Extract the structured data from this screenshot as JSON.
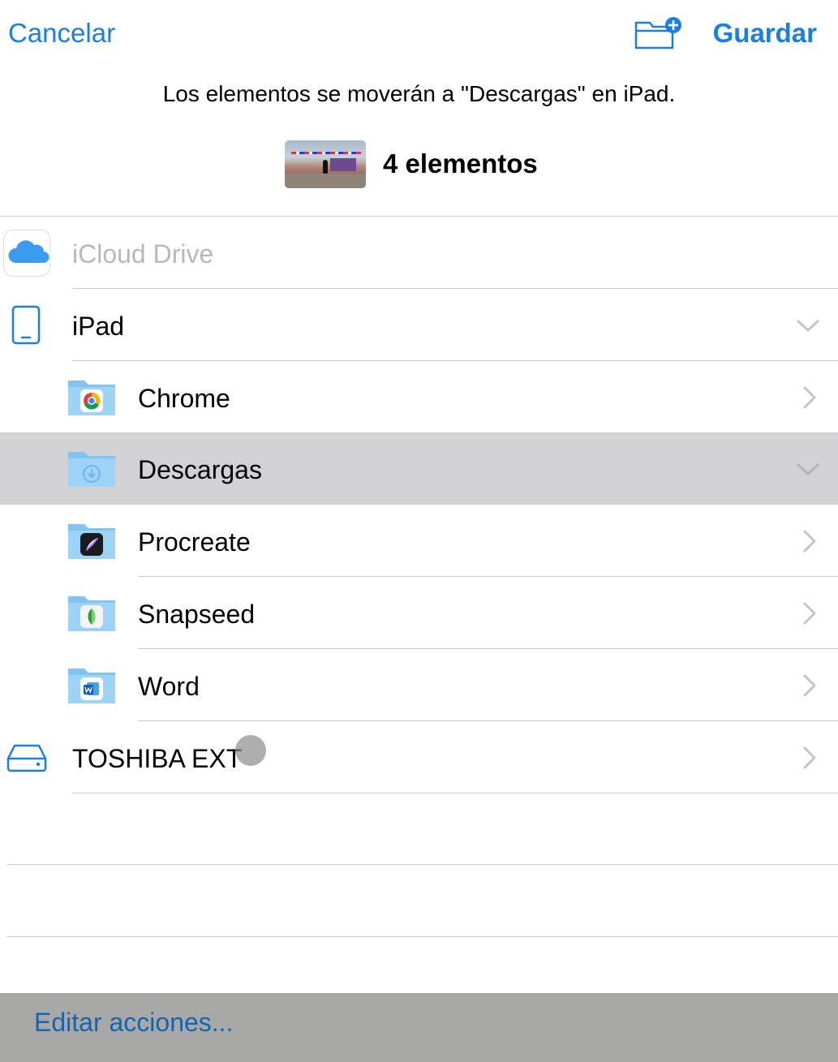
{
  "nav": {
    "cancel_label": "Cancelar",
    "save_label": "Guardar",
    "new_folder_icon": "folder-plus-icon",
    "accent_color": "#1a7fe4"
  },
  "header": {
    "destination_message": "Los elementos se moverán a \"Descargas\" en iPad.",
    "items_count": "4 elementos"
  },
  "locations": {
    "icloud": {
      "label": "iCloud Drive",
      "icon": "icloud-icon",
      "enabled": false
    },
    "ipad": {
      "label": "iPad",
      "icon": "ipad-icon",
      "expanded": true
    },
    "folders": [
      {
        "label": "Chrome",
        "badge": "chrome-icon",
        "selected": false
      },
      {
        "label": "Descargas",
        "badge": "download-icon",
        "selected": true
      },
      {
        "label": "Procreate",
        "badge": "procreate-icon",
        "selected": false
      },
      {
        "label": "Snapseed",
        "badge": "snapseed-icon",
        "selected": false
      },
      {
        "label": "Word",
        "badge": "word-icon",
        "selected": false
      }
    ],
    "external": {
      "label": "TOSHIBA EXT",
      "icon": "external-drive-icon"
    }
  },
  "toolbar": {
    "edit_actions_label": "Editar acciones..."
  }
}
